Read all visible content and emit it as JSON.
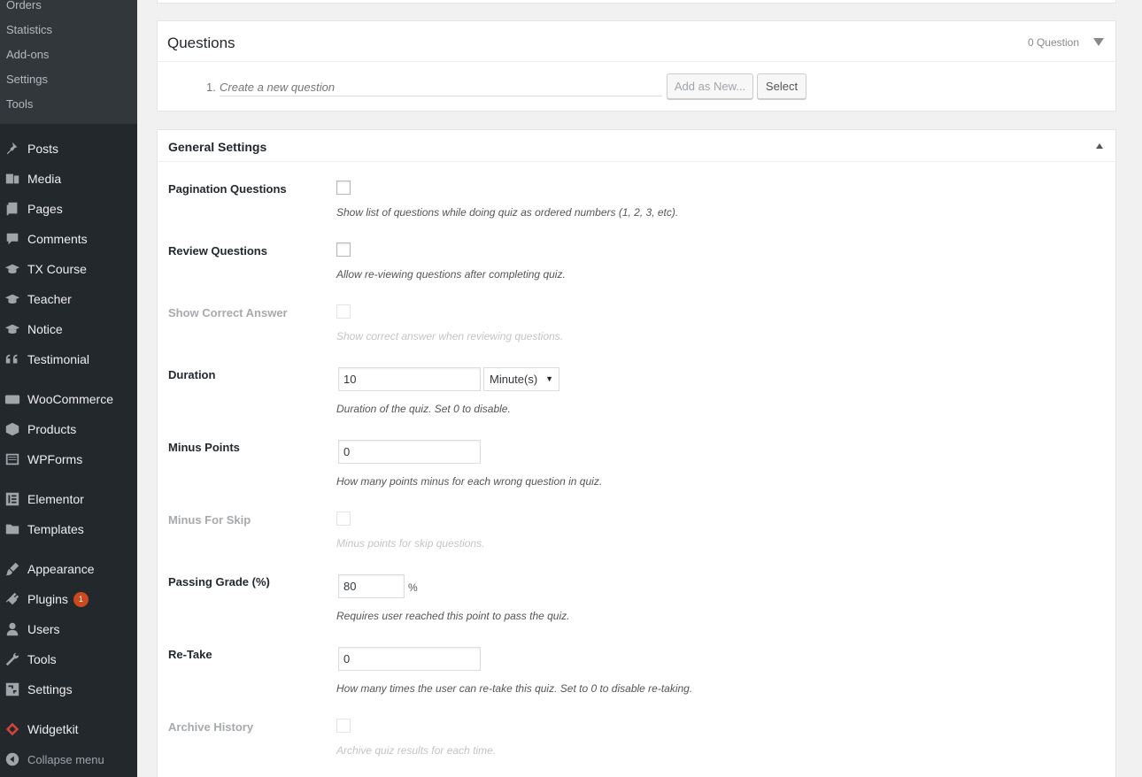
{
  "sidebar": {
    "submenu": [
      "Orders",
      "Statistics",
      "Add-ons",
      "Settings",
      "Tools"
    ],
    "items": [
      {
        "label": "Posts",
        "icon": "pin-icon"
      },
      {
        "label": "Media",
        "icon": "media-icon"
      },
      {
        "label": "Pages",
        "icon": "pages-icon"
      },
      {
        "label": "Comments",
        "icon": "comment-icon"
      },
      {
        "label": "TX Course",
        "icon": "graduation-cap-icon"
      },
      {
        "label": "Teacher",
        "icon": "graduation-cap-icon"
      },
      {
        "label": "Notice",
        "icon": "graduation-cap-icon"
      },
      {
        "label": "Testimonial",
        "icon": "quote-icon"
      },
      {
        "label": "WooCommerce",
        "icon": "woocommerce-icon"
      },
      {
        "label": "Products",
        "icon": "box-icon"
      },
      {
        "label": "WPForms",
        "icon": "form-icon"
      },
      {
        "label": "Elementor",
        "icon": "elementor-icon"
      },
      {
        "label": "Templates",
        "icon": "folder-icon"
      },
      {
        "label": "Appearance",
        "icon": "brush-icon"
      },
      {
        "label": "Plugins",
        "icon": "plugin-icon",
        "badge": "1"
      },
      {
        "label": "Users",
        "icon": "user-icon"
      },
      {
        "label": "Tools",
        "icon": "wrench-icon"
      },
      {
        "label": "Settings",
        "icon": "settings-icon"
      },
      {
        "label": "Widgetkit",
        "icon": "widgetkit-icon"
      }
    ],
    "collapse_label": "Collapse menu"
  },
  "questions": {
    "title": "Questions",
    "count": "0 Question",
    "row_number": "1.",
    "placeholder": "Create a new question",
    "add_button": "Add as New...",
    "select_button": "Select"
  },
  "general": {
    "title": "General Settings",
    "pagination": {
      "label": "Pagination Questions",
      "desc": "Show list of questions while doing quiz as ordered numbers (1, 2, 3, etc)."
    },
    "review": {
      "label": "Review Questions",
      "desc": "Allow re-viewing questions after completing quiz."
    },
    "correct": {
      "label": "Show Correct Answer",
      "desc": "Show correct answer when reviewing questions."
    },
    "duration": {
      "label": "Duration",
      "value": "10",
      "unit": "Minute(s)",
      "desc": "Duration of the quiz. Set 0 to disable."
    },
    "minus": {
      "label": "Minus Points",
      "value": "0",
      "desc": "How many points minus for each wrong question in quiz."
    },
    "skip": {
      "label": "Minus For Skip",
      "desc": "Minus points for skip questions."
    },
    "passing": {
      "label": "Passing Grade (%)",
      "value": "80",
      "unit": "%",
      "desc": "Requires user reached this point to pass the quiz."
    },
    "retake": {
      "label": "Re-Take",
      "value": "0",
      "desc": "How many times the user can re-take this quiz. Set to 0 to disable re-taking."
    },
    "archive": {
      "label": "Archive History",
      "desc": "Archive quiz results for each time."
    }
  },
  "colors": {
    "sidebar_bg": "#23282d",
    "submenu_bg": "#32373c",
    "badge": "#ca4a1f"
  }
}
